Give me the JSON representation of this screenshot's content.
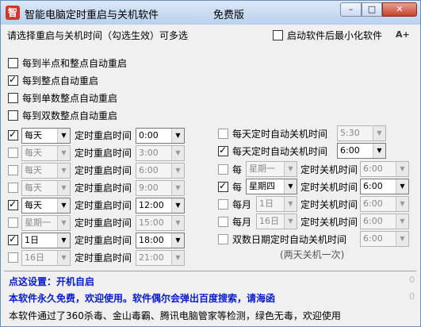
{
  "window": {
    "title": "智能电脑定时重启与关机软件",
    "edition": "免费版",
    "icon_char": "智",
    "min": "–",
    "max": "□",
    "close": "✕"
  },
  "instruction": "请选择重启与关机时间（勾选生效）可多选",
  "minimize_on_start": {
    "label": "启动软件后最小化软件",
    "checked": false
  },
  "font_size_icon": "A+",
  "hourly_options": [
    {
      "label": "每到半点和整点自动重启",
      "checked": false
    },
    {
      "label": "每到整点自动重启",
      "checked": true
    },
    {
      "label": "每到单数整点自动重启",
      "checked": false
    },
    {
      "label": "每到双数整点自动重启",
      "checked": false
    }
  ],
  "restart_label": "定时重启时间",
  "restart_rows": [
    {
      "checked": true,
      "freq": "每天",
      "time": "0:00",
      "enabled": true
    },
    {
      "checked": false,
      "freq": "每天",
      "time": "3:00",
      "enabled": false
    },
    {
      "checked": false,
      "freq": "每天",
      "time": "6:00",
      "enabled": false
    },
    {
      "checked": false,
      "freq": "每天",
      "time": "9:00",
      "enabled": false
    },
    {
      "checked": true,
      "freq": "每天",
      "time": "12:00",
      "enabled": true
    },
    {
      "checked": false,
      "freq": "星期一",
      "time": "15:00",
      "enabled": false
    },
    {
      "checked": true,
      "freq": "1日",
      "time": "18:00",
      "enabled": true
    },
    {
      "checked": false,
      "freq": "16日",
      "time": "21:00",
      "enabled": false
    }
  ],
  "shutdown_daily": [
    {
      "checked": false,
      "label": "每天定时自动关机时间",
      "time": "5:30",
      "enabled": false
    },
    {
      "checked": true,
      "label": "每天定时自动关机时间",
      "time": "6:00",
      "enabled": true
    }
  ],
  "shutdown_periodic_label": "定时关机时间",
  "shutdown_periodic": [
    {
      "checked": false,
      "prefix": "每",
      "freq": "星期一",
      "time": "6:00",
      "enabled": false
    },
    {
      "checked": true,
      "prefix": "每",
      "freq": "星期四",
      "time": "6:00",
      "enabled": true
    },
    {
      "checked": false,
      "prefix": "每月",
      "freq": "1日",
      "time": "6:00",
      "enabled": false
    },
    {
      "checked": false,
      "prefix": "每月",
      "freq": "16日",
      "time": "6:00",
      "enabled": false
    }
  ],
  "shutdown_even_day": {
    "checked": false,
    "label": "双数日期定时自动关机时间",
    "time": "6:00",
    "enabled": false
  },
  "shutdown_even_note": "(两天关机一次)",
  "footer": {
    "line1": "点这设置：开机自启",
    "line2": "本软件永久免费，欢迎使用。软件偶尔会弹出百度搜索，请海函",
    "line3": "本软件通过了360杀毒、金山毒霸、腾讯电脑管家等检测，绿色无毒，欢迎使用",
    "zero": "0"
  },
  "colors": {
    "title_gradient_top": "#dbe8f7",
    "footer_blue": "#0a1bd0",
    "close_red": "#c4402d"
  }
}
